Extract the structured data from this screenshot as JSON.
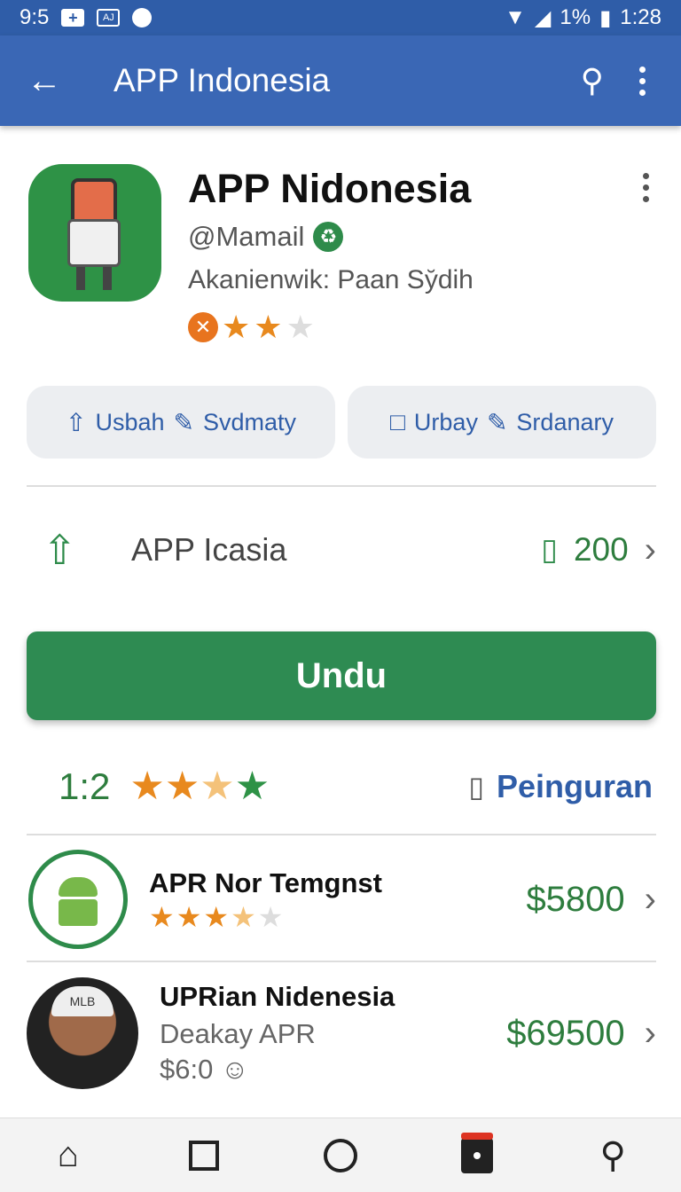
{
  "status_bar": {
    "time_left": "9:5",
    "battery_text": "1%",
    "time_right": "1:28",
    "icons": [
      "plus-icon",
      "aj-icon",
      "notification-icon",
      "wifi-icon",
      "signal-icon",
      "battery-icon"
    ]
  },
  "app_bar": {
    "title": "APP Indonesia",
    "icons": [
      "back-arrow-icon",
      "search-icon",
      "more-vert-icon"
    ]
  },
  "app_header": {
    "name": "APP Nidonesia",
    "handle": "@Mamail",
    "author": "Akanienwik: Paan Sy̆dih",
    "rating_filled": 2,
    "rating_total": 3
  },
  "actions": [
    {
      "left_label": "Usbah",
      "right_label": "Svdmaty"
    },
    {
      "left_label": "Urbay",
      "right_label": "Srdanary"
    }
  ],
  "size_row": {
    "label": "APP Icasia",
    "value": "200"
  },
  "install_button": {
    "label": "Undu",
    "color": "#2e8b52"
  },
  "rating_row": {
    "score": "1:2",
    "report_label": "Peinguran",
    "stars": [
      "on",
      "on",
      "half",
      "green"
    ]
  },
  "list": [
    {
      "title": "APR Nor Temgnst",
      "price": "$5800",
      "stars": [
        "on",
        "on",
        "on",
        "half",
        "off"
      ]
    },
    {
      "title": "UPRian Nidenesia",
      "subtitle": "Deakay APR",
      "meta": "$6:0",
      "price": "$69500",
      "cap_text": "MLB"
    }
  ],
  "colors": {
    "primary": "#3a67b5",
    "status_bar": "#2f5da8",
    "accent_green": "#2e8b52",
    "star_orange": "#e8891e"
  },
  "nav": [
    "home-icon",
    "square-icon",
    "circle-icon",
    "bookmark-icon",
    "profile-icon"
  ]
}
